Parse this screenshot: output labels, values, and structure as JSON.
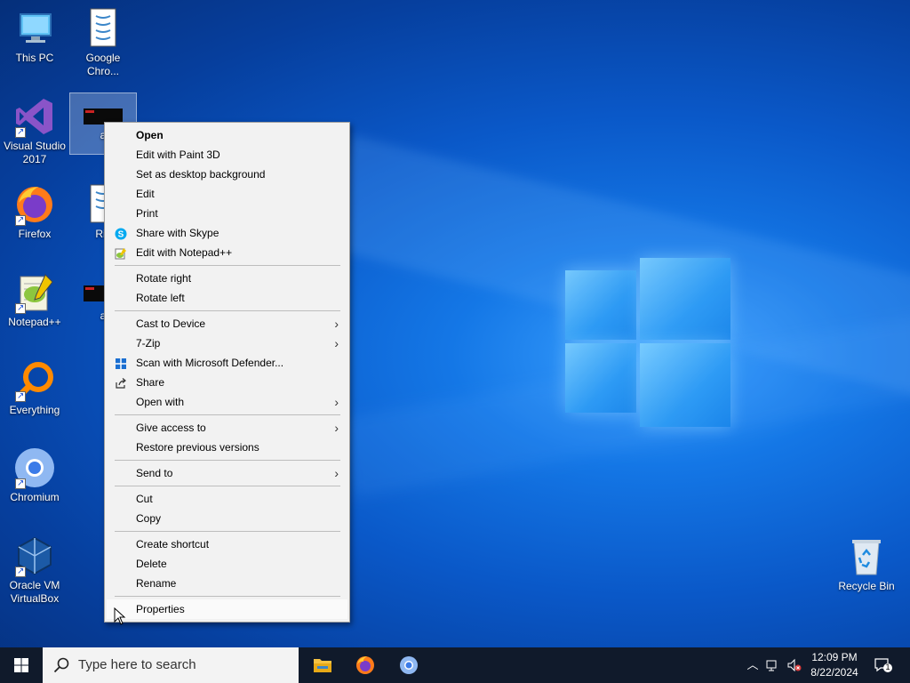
{
  "desktop": {
    "icons": {
      "this_pc": "This PC",
      "google_chrome": "Google Chro...",
      "visual_studio": "Visual Studio 2017",
      "selected_file": "a",
      "firefox": "Firefox",
      "riz": "Riz",
      "notepadpp": "Notepad++",
      "second_file": "a",
      "everything": "Everything",
      "chromium": "Chromium",
      "virtualbox": "Oracle VM VirtualBox",
      "recycle_bin": "Recycle Bin"
    }
  },
  "context_menu": {
    "items": {
      "open": "Open",
      "edit_paint3d": "Edit with Paint 3D",
      "set_background": "Set as desktop background",
      "edit": "Edit",
      "print": "Print",
      "share_skype": "Share with Skype",
      "edit_notepadpp": "Edit with Notepad++",
      "rotate_right": "Rotate right",
      "rotate_left": "Rotate left",
      "cast_device": "Cast to Device",
      "seven_zip": "7-Zip",
      "scan_defender": "Scan with Microsoft Defender...",
      "share": "Share",
      "open_with": "Open with",
      "give_access": "Give access to",
      "restore_versions": "Restore previous versions",
      "send_to": "Send to",
      "cut": "Cut",
      "copy": "Copy",
      "create_shortcut": "Create shortcut",
      "delete": "Delete",
      "rename": "Rename",
      "properties": "Properties"
    }
  },
  "taskbar": {
    "search_placeholder": "Type here to search",
    "time": "12:09 PM",
    "date": "8/22/2024",
    "notification_count": "1"
  },
  "colors": {
    "taskbar": "#101a2b",
    "menu_bg": "#f2f2f2",
    "accent": "#0078d7"
  }
}
